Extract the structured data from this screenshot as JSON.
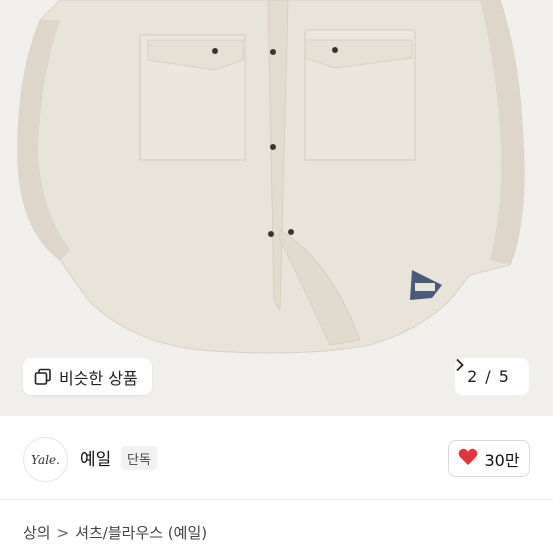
{
  "gallery": {
    "similar_label": "비슷한 상품",
    "page_current": "2",
    "page_separator": "/",
    "page_total": "5",
    "next_icon": "chevron-right-icon"
  },
  "shop": {
    "avatar_text": "Yale.",
    "name": "예일",
    "badge": "단독",
    "like_count": "30만",
    "heart_color": "#e0353e"
  },
  "breadcrumb": {
    "category": "상의",
    "separator": ">",
    "subcategory": "셔츠/블라우스 (예일)"
  }
}
